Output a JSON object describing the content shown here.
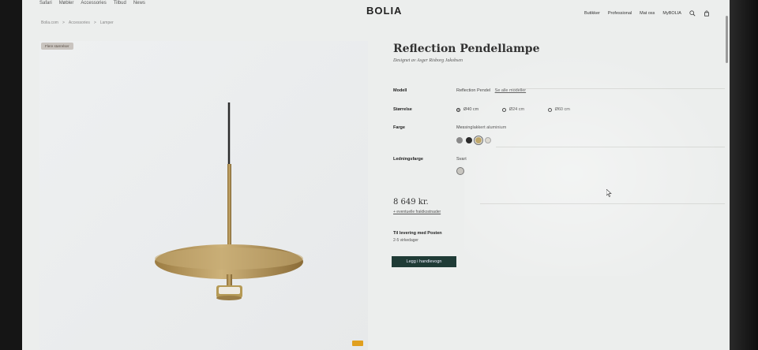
{
  "topnav": [
    "Safari",
    "Møbler",
    "Accessories",
    "Tilbud",
    "News"
  ],
  "logo": "BOLIA",
  "rightnav": [
    "Butikker",
    "Professional",
    "Mat oss",
    "MyBOLIA"
  ],
  "icons": [
    "search-icon",
    "bag-icon"
  ],
  "breadcrumb": [
    "Bolia.com",
    ">",
    "Accessories",
    ">",
    "Lamper"
  ],
  "tag": "Flere størrelser",
  "product": {
    "title": "Reflection Pendellampe",
    "designer": "Designet av Asger Risborg Jakobsen"
  },
  "model": {
    "label": "Modell",
    "value": "Reflection Pendel",
    "link": "Se alle modeller"
  },
  "size": {
    "label": "Størrelse",
    "options": [
      {
        "label": "Ø40 cm",
        "selected": true
      },
      {
        "label": "Ø24 cm",
        "selected": false
      },
      {
        "label": "Ø60 cm",
        "selected": false
      }
    ]
  },
  "color": {
    "label": "Farge",
    "value": "Messinglakkert aluminium",
    "swatches": [
      "#8a8a8a",
      "#111111",
      "#b59a55",
      "#d9d5cc"
    ]
  },
  "cord": {
    "label": "Ledningsfarge",
    "value": "Svart"
  },
  "price": "8 649 kr.",
  "freight": "+ eventuelle fraktkostnader",
  "delivery": {
    "title": "Til levering med Posten",
    "days": "2-5 virkedager"
  },
  "cart_button": "Legg i handlevogn",
  "colors": {
    "accent": "#1f3b36",
    "brass": "#b0935a"
  }
}
